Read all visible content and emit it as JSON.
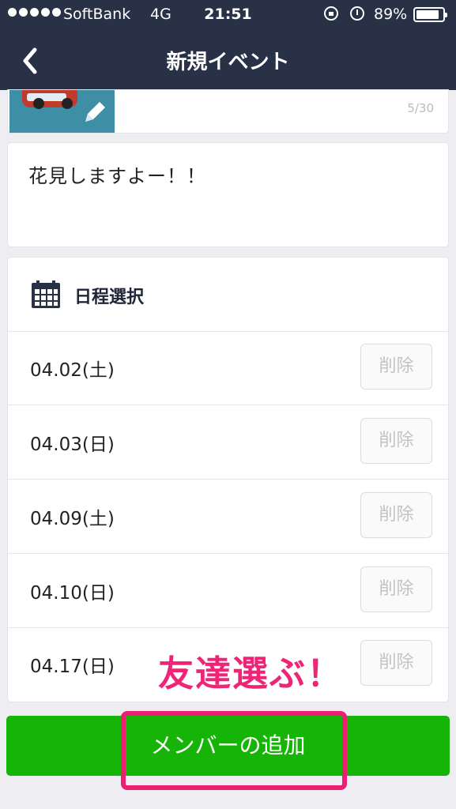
{
  "status_bar": {
    "carrier": "SoftBank",
    "network": "4G",
    "time": "21:51",
    "battery_pct": "89%",
    "battery_level": 0.89,
    "icons": [
      "signal-dots-icon",
      "rotation-lock-icon",
      "alarm-icon",
      "battery-icon"
    ]
  },
  "nav": {
    "title": "新規イベント",
    "back_icon": "chevron-left-icon"
  },
  "event": {
    "char_count": "5/30",
    "memo": "花見しますよー！！"
  },
  "schedule": {
    "header": "日程選択",
    "header_icon": "calendar-icon",
    "dates": [
      {
        "date": "04.02(土)",
        "delete_label": "削除"
      },
      {
        "date": "04.03(日)",
        "delete_label": "削除"
      },
      {
        "date": "04.09(土)",
        "delete_label": "削除"
      },
      {
        "date": "04.10(日)",
        "delete_label": "削除"
      },
      {
        "date": "04.17(日)",
        "delete_label": "削除"
      }
    ]
  },
  "actions": {
    "add_member": "メンバーの追加"
  },
  "annotation": "友達選ぶ！",
  "colors": {
    "navbar": "#283146",
    "add_button": "#16b406",
    "annotation": "#ec1f73"
  }
}
